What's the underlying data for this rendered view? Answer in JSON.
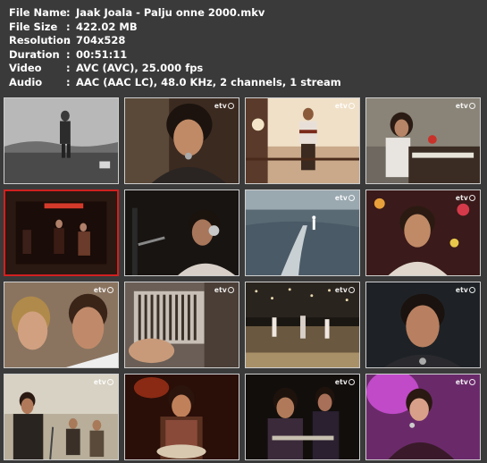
{
  "info": {
    "rows": [
      {
        "key": "File Name",
        "sep": ":",
        "value": "Jaak Joala - Palju onne  2000.mkv"
      },
      {
        "key": "File Size",
        "sep": ":",
        "value": "422.02 MB"
      },
      {
        "key": "Resolution",
        "sep": ":",
        "value": "704x528"
      },
      {
        "key": "Duration",
        "sep": ":",
        "value": "00:51:11"
      },
      {
        "key": "Video",
        "sep": ":",
        "value": "AVC (AVC), 25.000 fps"
      },
      {
        "key": "Audio",
        "sep": ":",
        "value": "AAC (AAC LC), 48.0 KHz, 2 channels, 1 stream"
      }
    ]
  },
  "channel_logo": "etv",
  "thumbnails": [
    {
      "scene": "singer on stage, black and white",
      "logo": false
    },
    {
      "scene": "singer close-up with microphone",
      "logo": true
    },
    {
      "scene": "singer on balcony with sea view",
      "logo": true
    },
    {
      "scene": "singer at organ keyboard",
      "logo": true
    },
    {
      "scene": "band on dark stage, red frame",
      "logo": false
    },
    {
      "scene": "singer with headphones and microphone",
      "logo": false
    },
    {
      "scene": "water skier on the sea",
      "logo": true
    },
    {
      "scene": "singer portrait with lights",
      "logo": true
    },
    {
      "scene": "two faces close-up",
      "logo": true
    },
    {
      "scene": "hands on accordion",
      "logo": true
    },
    {
      "scene": "stage show with dancers",
      "logo": true
    },
    {
      "scene": "singer with eyes closed",
      "logo": true
    },
    {
      "scene": "guitarists on outdoor stage",
      "logo": true
    },
    {
      "scene": "guitarist on stage red light",
      "logo": false
    },
    {
      "scene": "band with guitars dark stage",
      "logo": true
    },
    {
      "scene": "singer in pink light",
      "logo": true
    }
  ]
}
